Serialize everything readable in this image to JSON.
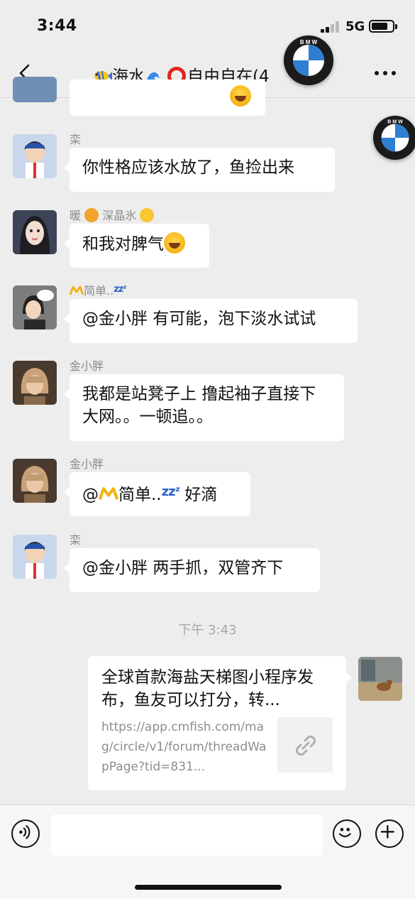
{
  "status_bar": {
    "time": "3:44",
    "network": "5G"
  },
  "nav": {
    "title": "海水",
    "title_suffix": "自由自在(4"
  },
  "messages": [
    {
      "sender": "",
      "text": ""
    },
    {
      "sender": "栾",
      "text": "你性格应该水放了，鱼捡出来"
    },
    {
      "sender": "暖",
      "sender_suffix": "深晶氷",
      "text": "和我对脾气"
    },
    {
      "sender": "简单..",
      "text": "@金小胖 有可能，泡下淡水试试"
    },
    {
      "sender": "金小胖",
      "text": "我都是站凳子上  撸起袖子直接下大网。。一顿追。。"
    },
    {
      "sender": "金小胖",
      "text_prefix": "@",
      "text_mid": "简单..",
      "text_suffix": " 好滴"
    },
    {
      "sender": "栾",
      "text": "@金小胖 两手抓，双管齐下"
    }
  ],
  "timestamp": "下午 3:43",
  "link_card": {
    "title": "全球首款海盐天梯图小程序发布，鱼友可以打分，转...",
    "url": "https://app.cmfish.com/mag/circle/v1/forum/threadWapPage?tid=831..."
  },
  "colors": {
    "background": "#ededed",
    "bubble": "#ffffff",
    "sender": "#8a8a8a",
    "ring": "#e1241b"
  },
  "icons": [
    "back-chevron-icon",
    "more-icon",
    "bmw-logo-icon",
    "voice-icon",
    "emoji-icon",
    "add-icon",
    "link-icon"
  ]
}
